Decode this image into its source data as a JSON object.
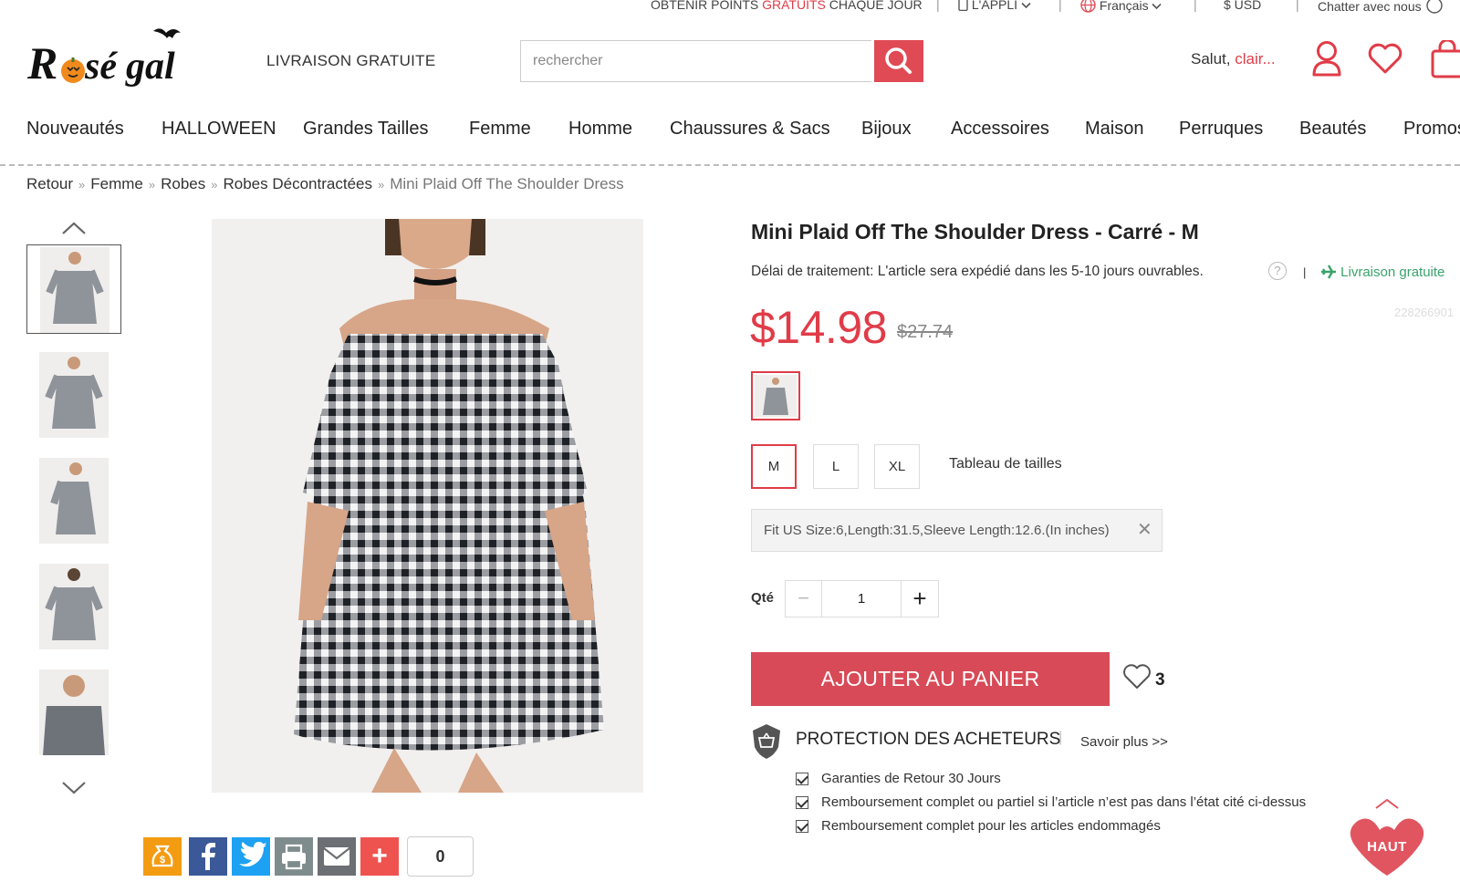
{
  "topbar": {
    "points_pre": "OBTENIR POINTS ",
    "points_red": "GRATUITS",
    "points_post": " CHAQUE JOUR",
    "app": "L'APPLI",
    "lang": "Français",
    "currency": "$ USD",
    "chat": "Chatter avec nous"
  },
  "header": {
    "logo_text": "Rosegal",
    "free_shipping": "LIVRAISON GRATUITE",
    "search_placeholder": "rechercher",
    "greet_prefix": "Salut,",
    "greet_user": "clair..."
  },
  "nav": [
    "Nouveautés",
    "HALLOWEEN",
    "Grandes Tailles",
    "Femme",
    "Homme",
    "Chaussures & Sacs",
    "Bijoux",
    "Accessoires",
    "Maison",
    "Perruques",
    "Beautés",
    "Promos"
  ],
  "breadcrumb": {
    "items": [
      "Retour",
      "Femme",
      "Robes",
      "Robes Décontractées"
    ],
    "current": "Mini Plaid Off The Shoulder Dress",
    "sep": "»"
  },
  "product": {
    "title": "Mini Plaid Off The Shoulder Dress - Carré - M",
    "delay_label": "Délai de traitement:",
    "delay_text": "L'article sera expédié dans les 5-10 jours ouvrables.",
    "help": "?",
    "sep": "|",
    "free_ship": "Livraison gratuite",
    "sku": "228266901",
    "price": "$14.98",
    "old_price": "$27.74",
    "sizes": [
      "M",
      "L",
      "XL"
    ],
    "selected_size": "M",
    "size_chart": "Tableau de tailles",
    "fit": "Fit US Size:6,Length:31.5,Sleeve Length:12.6.(In inches)",
    "qty_label": "Qté",
    "qty_minus": "−",
    "qty_value": "1",
    "qty_plus": "+",
    "add_to_cart": "AJOUTER AU PANIER",
    "wish_count": "3"
  },
  "protection": {
    "title": "PROTECTION DES ACHETEURS",
    "sep": "|",
    "learn_more": "Savoir plus >>",
    "items": [
      "Garanties de Retour 30 Jours",
      "Remboursement complet ou partiel si l’article n’est pas dans l’état cité ci-dessus",
      "Remboursement complet pour les articles endommagés"
    ]
  },
  "share": {
    "count": "0",
    "plus": "+"
  },
  "back_to_top": "HAUT",
  "colors": {
    "accent": "#e03c48",
    "cart": "#d84a57",
    "green": "#3aa36b",
    "facebook": "#3b5998",
    "twitter": "#1da1f2",
    "points": "#f39c12",
    "print": "#7f8c8d",
    "mail": "#6c6f73",
    "add": "#ef5350"
  }
}
